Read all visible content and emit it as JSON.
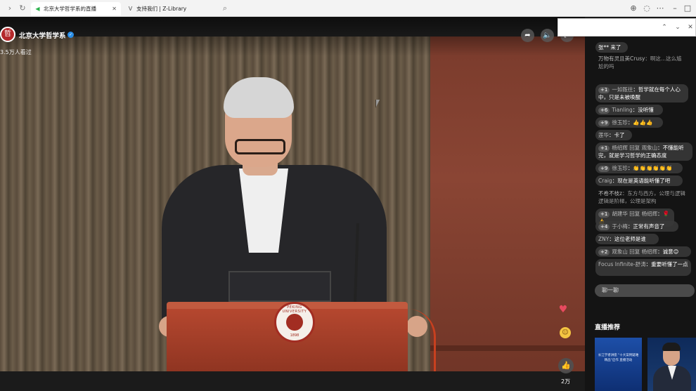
{
  "browser": {
    "tabs": [
      {
        "title": "北京大学哲学系的直播",
        "active": true,
        "icon": "speaker-icon",
        "has_close": true
      },
      {
        "title": "支持我们 | Z-Library",
        "active": false,
        "icon": "zlibrary-icon"
      }
    ]
  },
  "channel": {
    "logo_char": "哲",
    "name": "北京大学哲学系",
    "viewers": "3.5万人看过"
  },
  "video": {
    "podium_seal_text": "PEKING UNIVERSITY",
    "podium_seal_year": "1898",
    "like_count": "2万"
  },
  "chat": {
    "messages": [
      {
        "user": "张** 来了",
        "text": "",
        "faded": false,
        "badge": ""
      },
      {
        "user": "万物有灵且美Crusy",
        "text": "：啊这...这么尴尬的吗",
        "faded": true,
        "badge": ""
      },
      {
        "user": "一如既往",
        "text": "：哲学就在每个人心中，只是未被唤醒",
        "faded": false,
        "badge": "1"
      },
      {
        "user": "Tianling",
        "text": "：没听懂",
        "faded": false,
        "badge": "6"
      },
      {
        "user": "徐玉珍",
        "text": "：👍👍👍",
        "faded": false,
        "badge": "9"
      },
      {
        "user": "莲华",
        "text": "：卡了",
        "faded": false,
        "badge": ""
      },
      {
        "user": "杨绍辉 回复 观象山",
        "text": "：不懂能听完，就是学习哲学的正确态度",
        "faded": false,
        "badge": "1"
      },
      {
        "user": "徐玉珍",
        "text": "：👏👏👏👏👏👏",
        "faded": false,
        "badge": "9"
      },
      {
        "user": "Craig",
        "text": "：现在是英语能听懂了吧",
        "faded": false,
        "badge": ""
      },
      {
        "user": "不卷不枝z",
        "text": "：东方与西方，公理与逻辑 逻辑是阶梯，公理是架构",
        "faded": true,
        "badge": ""
      },
      {
        "user": "胡建华 回复 杨绍辉",
        "text": "：🌹👍",
        "faded": false,
        "badge": "1"
      },
      {
        "user": "于小梅",
        "text": "：正常有声音了",
        "faded": false,
        "badge": "4"
      },
      {
        "user": "ZNY",
        "text": "：这位老师是谁",
        "faded": false,
        "badge": ""
      },
      {
        "user": "观象山 回复 杨绍辉",
        "text": "：诚意😊",
        "faded": false,
        "badge": "2"
      },
      {
        "user": "Focus Infinite-舒涛",
        "text": "：重要听懂了一点",
        "faded": false,
        "badge": ""
      }
    ],
    "input_placeholder": "聊一聊"
  },
  "recommend": {
    "title": "直播推荐",
    "card1_text": "长江学者讲座 \"十大案例疑难精品\"启作 直播活动"
  },
  "colors": {
    "accent_red": "#b4292b",
    "verified_blue": "#2b8fe8"
  }
}
